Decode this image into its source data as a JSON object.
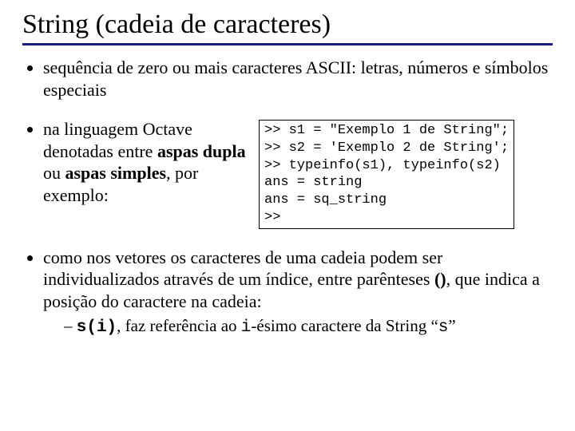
{
  "title": "String (cadeia de caracteres)",
  "bullet1": "sequência de zero ou mais caracteres ASCII: letras, números e símbolos especiais",
  "bullet2_pre": "na linguagem Octave denotadas entre ",
  "bullet2_bold1": "aspas dupla",
  "bullet2_mid": " ou ",
  "bullet2_bold2": "aspas simples",
  "bullet2_post": ", por exemplo:",
  "code": ">> s1 = \"Exemplo 1 de String\";\n>> s2 = 'Exemplo 2 de String';\n>> typeinfo(s1), typeinfo(s2)\nans = string\nans = sq_string\n>>",
  "bullet3_a": "como nos vetores os caracteres de uma cadeia podem ser individualizados através de um índice, entre parênteses ",
  "bullet3_paren": "()",
  "bullet3_b": ", que indica a posição do caractere na cadeia:",
  "sub_code1": "s(i)",
  "sub_mid1": ", faz referência ao ",
  "sub_code2": "i",
  "sub_mid2": "-ésimo caractere da String “",
  "sub_code3": "s",
  "sub_end": "”"
}
